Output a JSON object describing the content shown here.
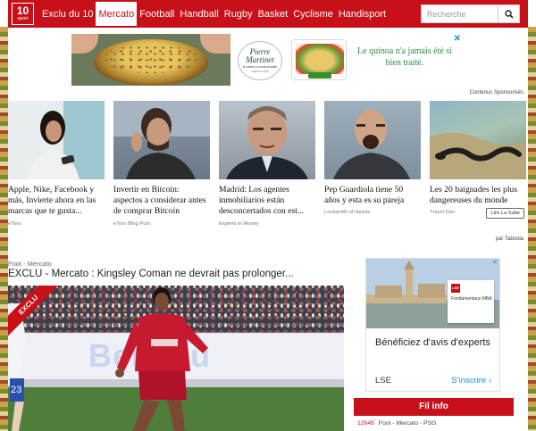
{
  "nav": {
    "logo_big": "10",
    "logo_small": "sport",
    "links": [
      {
        "label": "Exclu du 10",
        "active": false
      },
      {
        "label": "Mercato",
        "active": true
      },
      {
        "label": "Football",
        "active": false
      },
      {
        "label": "Handball",
        "active": false
      },
      {
        "label": "Rugby",
        "active": false
      },
      {
        "label": "Basket",
        "active": false
      },
      {
        "label": "Cyclisme",
        "active": false
      },
      {
        "label": "Handisport",
        "active": false
      }
    ],
    "search_placeholder": "Recherche",
    "search_icon": "search-icon"
  },
  "ad_banner": {
    "brand_line1": "Pierre",
    "brand_line2": "Martinet",
    "brand_tagline": "le traiteur incontournable",
    "brand_since": "DEPUIS 1968",
    "text": "Le quinoa n'a jamais été si bien traité.",
    "close_icon": "close-icon"
  },
  "sponsored_label": "Contenus Sponsorisés",
  "cards": [
    {
      "title": "Apple, Nike, Facebook y más, Invierte ahora en las marcas que te gusta...",
      "source": "eToro",
      "button": ""
    },
    {
      "title": "Invertir en Bitcoin: aspectos a considerar antes de comprar Bitcoin",
      "source": "eToro Blog Post",
      "button": ""
    },
    {
      "title": "Madrid: Los agentes inmobiliarios están desconcertados con est...",
      "source": "Experts in Money",
      "button": ""
    },
    {
      "title": "Pep Guardiola tiene 50 años y esta es su pareja",
      "source": "Locksmith of Hearts",
      "button": ""
    },
    {
      "title": "Les 20 baignades les plus dangereuses du monde",
      "source": "Travel Den",
      "button": "Lire La Suite"
    }
  ],
  "by_taboola": "par Taboola",
  "article": {
    "breadcrumb": "Foot - Mercato",
    "title": "EXCLU - Mercato : Kingsley Coman ne devrait pas prolonger...",
    "ribbon": "EXCLU",
    "adboard": "Bei you"
  },
  "right_ad": {
    "card_logo": "LSE",
    "card_text": "Fondamentaux MBA",
    "headline": "Bénéficiez d'avis d'experts",
    "brand": "LSE",
    "cta": "S'inscrire",
    "cta_icon": "chevron-right-icon",
    "close_icon": "ad-choices-icon"
  },
  "fil_info": {
    "title": "Fil info",
    "items": [
      {
        "time": "12h45",
        "text": "Foot - Mercato - PSG"
      }
    ]
  },
  "colors": {
    "brand_red": "#c8101a",
    "ad_green": "#2c8c3c",
    "link_blue": "#1a8fd6"
  }
}
